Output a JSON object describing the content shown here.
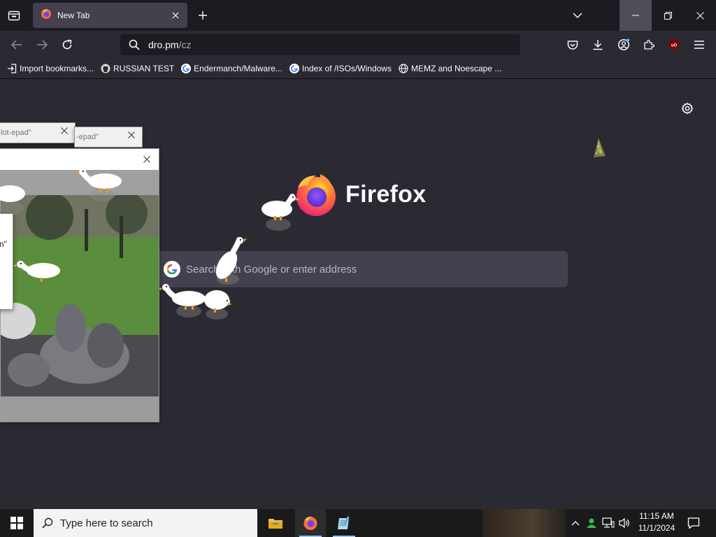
{
  "browser": {
    "tab": {
      "title": "New Tab"
    },
    "url": {
      "host": "dro.pm",
      "path": "/cz"
    },
    "bookmarks": [
      {
        "label": "Import bookmarks...",
        "icon": "import-icon"
      },
      {
        "label": "RUSSIAN TEST",
        "icon": "github-icon"
      },
      {
        "label": "Endermanch/Malware...",
        "icon": "google-icon"
      },
      {
        "label": "Index of /ISOs/Windows",
        "icon": "google-icon"
      },
      {
        "label": "MEMZ and Noescape ...",
        "icon": "globe-icon"
      }
    ]
  },
  "newtab": {
    "brand": "Firefox",
    "search_placeholder": "Search with Google or enter address"
  },
  "popups": {
    "title_a": "lot-epad\"",
    "title_b": "-epad\"",
    "fragment": "n\""
  },
  "taskbar": {
    "search_placeholder": "Type here to search",
    "time": "11:15 AM",
    "date": "11/1/2024"
  },
  "colors": {
    "accent_firefox": "#ff7139",
    "taskbar_bg": "#1a1a1a",
    "page_bg": "#2b2a33"
  }
}
